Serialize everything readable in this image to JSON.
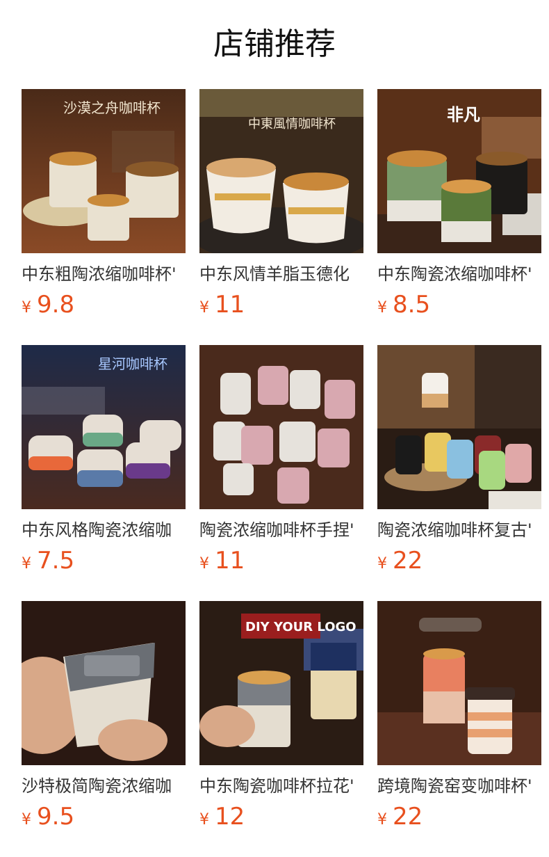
{
  "section": {
    "title": "店铺推荐"
  },
  "products": [
    {
      "title": "中东粗陶浓缩咖啡杯'",
      "currency": "¥",
      "price": "9.8",
      "image_text": "沙漠之舟咖啡杯",
      "image_icon": "photo-ceramic-cups-sand"
    },
    {
      "title": "中东风情羊脂玉德化",
      "currency": "¥",
      "price": "11",
      "image_text": "中東風情咖啡杯",
      "image_icon": "photo-cappuccino-cups"
    },
    {
      "title": "中东陶瓷浓缩咖啡杯'",
      "currency": "¥",
      "price": "8.5",
      "image_text": "非凡",
      "image_icon": "photo-green-black-cups"
    },
    {
      "title": "中东风格陶瓷浓缩咖",
      "currency": "¥",
      "price": "7.5",
      "image_text": "星河咖啡杯",
      "image_icon": "photo-starry-cups"
    },
    {
      "title": "陶瓷浓缩咖啡杯手捏'",
      "currency": "¥",
      "price": "11",
      "image_text": "",
      "image_icon": "photo-pink-white-cups"
    },
    {
      "title": "陶瓷浓缩咖啡杯复古'",
      "currency": "¥",
      "price": "22",
      "image_text": "",
      "image_icon": "photo-colorful-cups"
    },
    {
      "title": "沙特极简陶瓷浓缩咖",
      "currency": "¥",
      "price": "9.5",
      "image_text": "",
      "image_icon": "photo-hand-grey-cup"
    },
    {
      "title": "中东陶瓷咖啡杯拉花'",
      "currency": "¥",
      "price": "12",
      "image_text": "DIY YOUR LOGO",
      "image_icon": "photo-logo-cups"
    },
    {
      "title": "跨境陶瓷窑变咖啡杯'",
      "currency": "¥",
      "price": "22",
      "image_text": "",
      "image_icon": "photo-glaze-cups"
    }
  ]
}
